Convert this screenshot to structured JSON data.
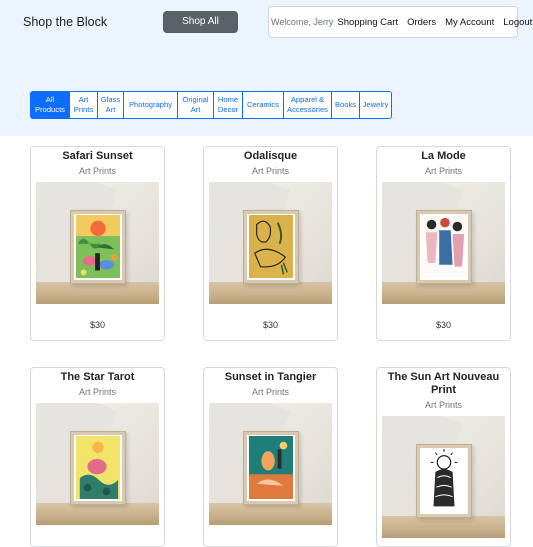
{
  "header": {
    "brand": "Shop the Block",
    "shop_all_label": "Shop All",
    "welcome": "Welcome, Jerry",
    "links": [
      "Shopping Cart",
      "Orders",
      "My Account",
      "Logout"
    ]
  },
  "categories": [
    {
      "line1": "All",
      "line2": "Products",
      "active": true
    },
    {
      "line1": "Art",
      "line2": "Prints"
    },
    {
      "line1": "Glass",
      "line2": "Art"
    },
    {
      "line1": "Photography",
      "line2": ""
    },
    {
      "line1": "Original",
      "line2": "Art"
    },
    {
      "line1": "Home",
      "line2": "Decor"
    },
    {
      "line1": "Ceramics",
      "line2": ""
    },
    {
      "line1": "Apparel &",
      "line2": "Accessories"
    },
    {
      "line1": "Books",
      "line2": ""
    },
    {
      "line1": "Jewelry",
      "line2": ""
    }
  ],
  "products": [
    {
      "title": "Safari Sunset",
      "category": "Art Prints",
      "price": "$30",
      "art": "safari"
    },
    {
      "title": "Odalisque",
      "category": "Art Prints",
      "price": "$30",
      "art": "odalisque"
    },
    {
      "title": "La Mode",
      "category": "Art Prints",
      "price": "$30",
      "art": "lamode"
    },
    {
      "title": "The Star Tarot",
      "category": "Art Prints",
      "price": "",
      "art": "startarot"
    },
    {
      "title": "Sunset in Tangier",
      "category": "Art Prints",
      "price": "",
      "art": "tangier"
    },
    {
      "title": "The Sun Art Nouveau Print",
      "category": "Art Prints",
      "price": "",
      "art": "sunnouveau"
    }
  ]
}
